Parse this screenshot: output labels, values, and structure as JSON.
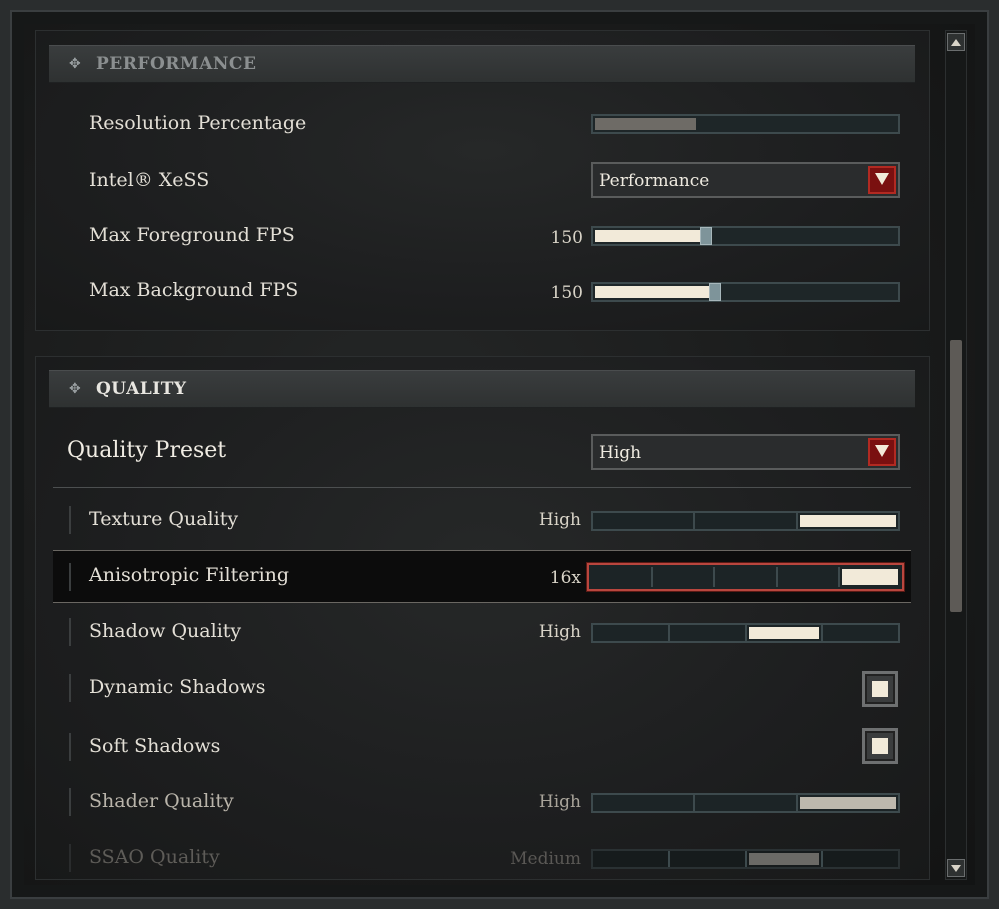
{
  "performance": {
    "title": "PERFORMANCE",
    "rows": {
      "resolution_percentage": {
        "label": "Resolution Percentage",
        "fill": 0.33
      },
      "xess": {
        "label": "Intel® XeSS",
        "value": "Performance"
      },
      "max_foreground_fps": {
        "label": "Max Foreground FPS",
        "value": "150",
        "fill": 0.35
      },
      "max_background_fps": {
        "label": "Max Background FPS",
        "value": "150",
        "fill": 0.38
      }
    }
  },
  "quality": {
    "title": "QUALITY",
    "preset": {
      "label": "Quality Preset",
      "value": "High"
    },
    "rows": {
      "texture_quality": {
        "label": "Texture Quality",
        "value": "High",
        "segments": 3,
        "selected": 3
      },
      "anisotropic_filtering": {
        "label": "Anisotropic Filtering",
        "value": "16x",
        "segments": 5,
        "selected": 5
      },
      "shadow_quality": {
        "label": "Shadow Quality",
        "value": "High",
        "segments": 4,
        "selected": 3
      },
      "dynamic_shadows": {
        "label": "Dynamic Shadows",
        "checked": true
      },
      "soft_shadows": {
        "label": "Soft Shadows",
        "checked": true
      },
      "shader_quality": {
        "label": "Shader Quality",
        "value": "High",
        "segments": 3,
        "selected": 3
      },
      "ssao_quality": {
        "label": "SSAO Quality",
        "value": "Medium",
        "segments": 4,
        "selected": 3
      }
    }
  },
  "colors": {
    "accent_red": "#7a1010",
    "fill_cream": "#f2ead9",
    "slider_track": "#1e2628"
  },
  "scrollbar": {
    "up_icon": "arrow-up-icon",
    "down_icon": "arrow-down-icon"
  }
}
